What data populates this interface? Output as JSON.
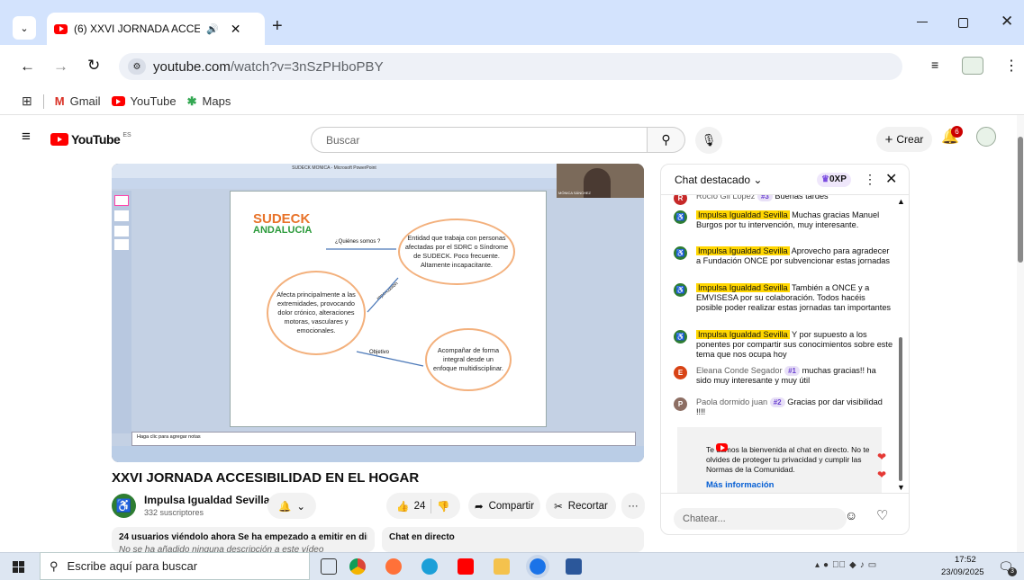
{
  "browser": {
    "tab_title": "(6) XXVI JORNADA ACCESIBILIDAD EN EL HOGAR",
    "tab_title_visible": "(6) XXVI JORNADA ACCESIB",
    "url_domain": "youtube.com",
    "url_path": "/watch?v=3nSzPHboPBY",
    "bookmarks": [
      "Gmail",
      "YouTube",
      "Maps"
    ]
  },
  "youtube": {
    "logo_text": "YouTube",
    "region": "ES",
    "search_placeholder": "Buscar",
    "create_label": "Crear",
    "notification_count": "6"
  },
  "video": {
    "title": "XXVI JORNADA ACCESIBILIDAD EN EL HOGAR",
    "channel_name": "Impulsa Igualdad Sevilla",
    "subscribers": "332 suscriptores",
    "likes": "24",
    "share_label": "Compartir",
    "clip_label": "Recortar",
    "more_label": "···",
    "description_header": "24 usuarios viéndolo ahora  Se ha empezado a emitir en directo",
    "description_text": "No se ha añadido ninguna descripción a este vídeo",
    "live_chat_label": "Chat en directo",
    "slide": {
      "ppt_title": "SUDECK MONICA - Microsoft PowerPoint",
      "brand_line1": "SUDECK",
      "brand_line2": "ANDALUCIA",
      "q_label": "¿Quiénes somos ?",
      "bubble1": "Entidad que trabaja con personas afectadas por el SDRC o Síndrome de SUDECK. Poco frecuente. Altamente incapacitante.",
      "repercusion": "repercusión",
      "bubble2": "Afecta principalmente a las extremidades, provocando dolor crónico, alteraciones motoras, vasculares y emocionales.",
      "objetivo": "Objetivo",
      "bubble3": "Acompañar de forma integral desde un enfoque multidisciplinar.",
      "notes": "Haga clic para agregar notas",
      "speaker": "MÓNICA SÁNCHEZ"
    }
  },
  "chat": {
    "header": "Chat destacado",
    "xp": "0XP",
    "messages": [
      {
        "author": "Rocío Gil López",
        "badge": "#3",
        "text": "Buenas tardes",
        "avatar": "R",
        "color": "#c62828"
      },
      {
        "author": "Impulsa Igualdad Sevilla",
        "highlight": true,
        "text": "Muchas gracias Manuel Burgos por tu intervención, muy interesante.",
        "avatar": "♿",
        "color": "#2e7d32"
      },
      {
        "author": "Impulsa Igualdad Sevilla",
        "highlight": true,
        "text": "Aprovecho para agradecer a Fundación ONCE por subvencionar estas jornadas",
        "avatar": "♿",
        "color": "#2e7d32"
      },
      {
        "author": "Impulsa Igualdad Sevilla",
        "highlight": true,
        "text": "También a ONCE y a EMVISESA por su colaboración. Todos hacéis posible poder realizar estas jornadas tan importantes",
        "avatar": "♿",
        "color": "#2e7d32"
      },
      {
        "author": "Impulsa Igualdad Sevilla",
        "highlight": true,
        "text": "Y por supuesto a los ponentes por compartir sus conocimientos sobre este tema que nos ocupa hoy",
        "avatar": "♿",
        "color": "#2e7d32"
      },
      {
        "author": "Eleana Conde Segador",
        "badge": "#1",
        "text": "muchas gracias!! ha sido muy interesante y muy útil",
        "avatar": "E",
        "color": "#d84315"
      },
      {
        "author": "Paola dormido juan",
        "badge": "#2",
        "text": "Gracias por dar visibilidad !!!!",
        "avatar": "P",
        "color": "#8d6e63"
      }
    ],
    "notice": "Te damos la bienvenida al chat en directo. No te olvides de proteger tu privacidad y cumplir las Normas de la Comunidad.",
    "more_info": "Más información",
    "input_placeholder": "Chatear..."
  },
  "taskbar": {
    "search_placeholder": "Escribe aquí para buscar",
    "time": "17:52",
    "date": "23/09/2025",
    "notif_count": "3"
  }
}
